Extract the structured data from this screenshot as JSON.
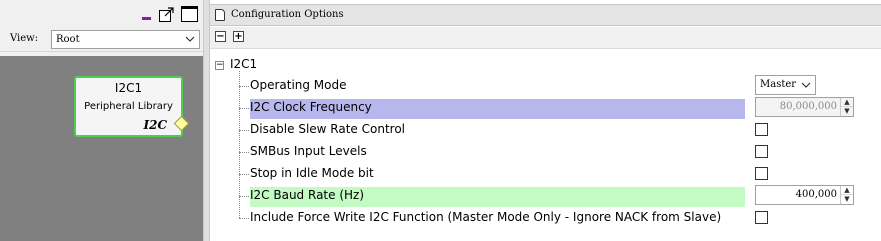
{
  "left_panel": {
    "view_label": "View:",
    "view_value": "Root",
    "component": {
      "title": "I2C1",
      "subtitle": "Peripheral Library",
      "tag": "I2C"
    }
  },
  "right_panel": {
    "title": "Configuration Options",
    "collapse_all": "−",
    "expand_all": "+",
    "tree": {
      "root_toggle": "−",
      "root_label": "I2C1",
      "options": [
        {
          "label": "Operating Mode",
          "control": "select",
          "value": "Master",
          "highlight": ""
        },
        {
          "label": "I2C Clock Frequency",
          "control": "spinner",
          "value": "80,000,000",
          "disabled": true,
          "highlight": "blue"
        },
        {
          "label": "Disable Slew Rate Control",
          "control": "checkbox",
          "checked": false,
          "highlight": ""
        },
        {
          "label": "SMBus Input Levels",
          "control": "checkbox",
          "checked": false,
          "highlight": ""
        },
        {
          "label": "Stop in Idle Mode bit",
          "control": "checkbox",
          "checked": false,
          "highlight": ""
        },
        {
          "label": "I2C Baud Rate (Hz)",
          "control": "spinner",
          "value": "400,000",
          "disabled": false,
          "highlight": "green"
        },
        {
          "label": "Include Force Write I2C Function (Master Mode Only - Ignore NACK from Slave)",
          "control": "checkbox",
          "checked": false,
          "highlight": ""
        }
      ]
    }
  },
  "colors": {
    "highlight_blue": "#b7b7ee",
    "highlight_green": "#c4fbc4",
    "component_border": "#53cc53",
    "canvas_background": "#808080"
  }
}
